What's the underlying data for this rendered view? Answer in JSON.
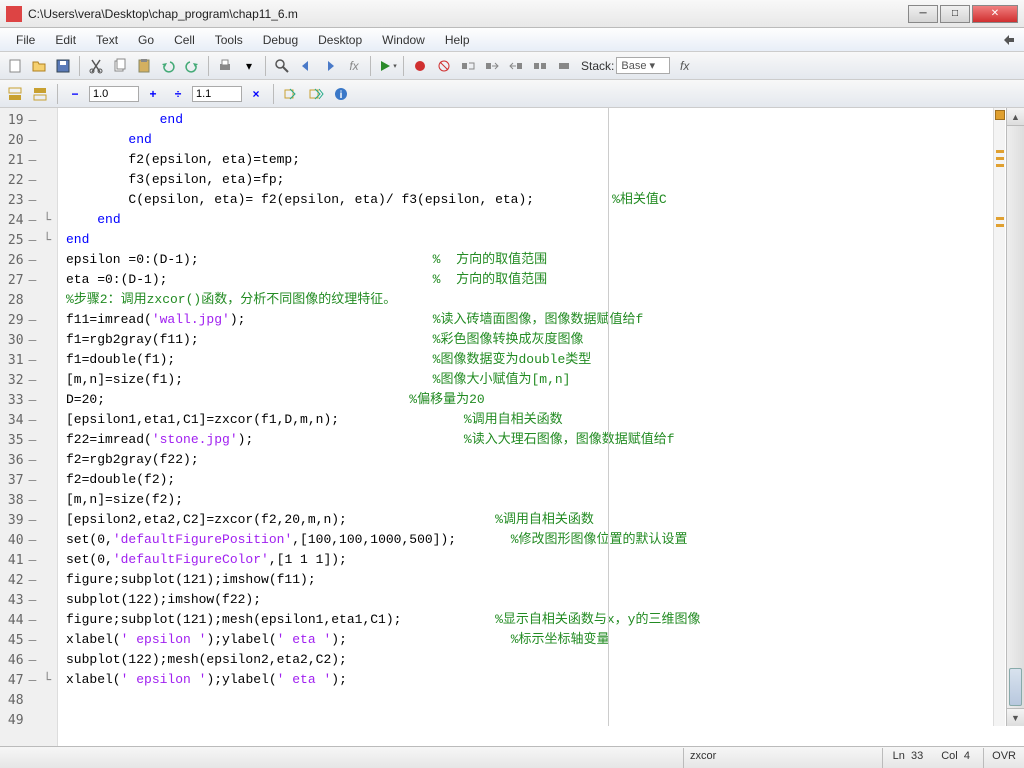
{
  "title": "C:\\Users\\vera\\Desktop\\chap_program\\chap11_6.m",
  "menu": [
    "File",
    "Edit",
    "Text",
    "Go",
    "Cell",
    "Tools",
    "Debug",
    "Desktop",
    "Window",
    "Help"
  ],
  "toolbar2": {
    "field1": "1.0",
    "field2": "1.1"
  },
  "stack": {
    "label": "Stack:",
    "value": "Base"
  },
  "gutter": [
    {
      "n": "19",
      "d": "—",
      "f": ""
    },
    {
      "n": "20",
      "d": "—",
      "f": ""
    },
    {
      "n": "21",
      "d": "—",
      "f": ""
    },
    {
      "n": "22",
      "d": "—",
      "f": ""
    },
    {
      "n": "23",
      "d": "—",
      "f": ""
    },
    {
      "n": "24",
      "d": "—",
      "f": "└"
    },
    {
      "n": "25",
      "d": "—",
      "f": "└"
    },
    {
      "n": "26",
      "d": "—",
      "f": ""
    },
    {
      "n": "27",
      "d": "—",
      "f": ""
    },
    {
      "n": "28",
      "d": "",
      "f": ""
    },
    {
      "n": "29",
      "d": "—",
      "f": ""
    },
    {
      "n": "30",
      "d": "—",
      "f": ""
    },
    {
      "n": "31",
      "d": "—",
      "f": ""
    },
    {
      "n": "32",
      "d": "—",
      "f": ""
    },
    {
      "n": "33",
      "d": "—",
      "f": ""
    },
    {
      "n": "34",
      "d": "—",
      "f": ""
    },
    {
      "n": "35",
      "d": "—",
      "f": ""
    },
    {
      "n": "36",
      "d": "—",
      "f": ""
    },
    {
      "n": "37",
      "d": "—",
      "f": ""
    },
    {
      "n": "38",
      "d": "—",
      "f": ""
    },
    {
      "n": "39",
      "d": "—",
      "f": ""
    },
    {
      "n": "40",
      "d": "—",
      "f": ""
    },
    {
      "n": "41",
      "d": "—",
      "f": ""
    },
    {
      "n": "42",
      "d": "—",
      "f": ""
    },
    {
      "n": "43",
      "d": "—",
      "f": ""
    },
    {
      "n": "44",
      "d": "—",
      "f": ""
    },
    {
      "n": "45",
      "d": "—",
      "f": ""
    },
    {
      "n": "46",
      "d": "—",
      "f": ""
    },
    {
      "n": "47",
      "d": "—",
      "f": "└"
    },
    {
      "n": "48",
      "d": "",
      "f": ""
    },
    {
      "n": "49",
      "d": "",
      "f": ""
    }
  ],
  "code": [
    {
      "seg": [
        {
          "t": "            ",
          "c": ""
        },
        {
          "t": "end",
          "c": "kw"
        }
      ]
    },
    {
      "seg": [
        {
          "t": "        ",
          "c": ""
        },
        {
          "t": "end",
          "c": "kw"
        }
      ]
    },
    {
      "seg": [
        {
          "t": "        f2(epsilon, eta)=temp;",
          "c": ""
        }
      ]
    },
    {
      "seg": [
        {
          "t": "        f3(epsilon, eta)=fp;",
          "c": ""
        }
      ]
    },
    {
      "seg": [
        {
          "t": "        C(epsilon, eta)= f2(epsilon, eta)/ f3(epsilon, eta);          ",
          "c": ""
        },
        {
          "t": "%相关值C",
          "c": "cmt"
        }
      ]
    },
    {
      "seg": [
        {
          "t": "    ",
          "c": ""
        },
        {
          "t": "end",
          "c": "kw"
        }
      ]
    },
    {
      "seg": [
        {
          "t": "end",
          "c": "kw"
        }
      ]
    },
    {
      "seg": [
        {
          "t": "epsilon =0:(D-1);                              ",
          "c": ""
        },
        {
          "t": "%  方向的取值范围",
          "c": "cmt"
        }
      ]
    },
    {
      "seg": [
        {
          "t": "eta =0:(D-1);                                  ",
          "c": ""
        },
        {
          "t": "%  方向的取值范围",
          "c": "cmt"
        }
      ]
    },
    {
      "seg": [
        {
          "t": "%步骤2：调用zxcor()函数，分析不同图像的纹理特征。",
          "c": "cmt"
        }
      ]
    },
    {
      "seg": [
        {
          "t": "f11=imread(",
          "c": ""
        },
        {
          "t": "'wall.jpg'",
          "c": "str"
        },
        {
          "t": ");                        ",
          "c": ""
        },
        {
          "t": "%读入砖墙面图像，图像数据赋值给f",
          "c": "cmt"
        }
      ]
    },
    {
      "seg": [
        {
          "t": "f1=rgb2gray(f11);                              ",
          "c": ""
        },
        {
          "t": "%彩色图像转换成灰度图像",
          "c": "cmt"
        }
      ]
    },
    {
      "seg": [
        {
          "t": "f1=double(f1);                                 ",
          "c": ""
        },
        {
          "t": "%图像数据变为double类型",
          "c": "cmt"
        }
      ]
    },
    {
      "seg": [
        {
          "t": "[m,n]=size(f1);                                ",
          "c": ""
        },
        {
          "t": "%图像大小赋值为[m,n]",
          "c": "cmt"
        }
      ]
    },
    {
      "seg": [
        {
          "t": "D=20;                                       ",
          "c": ""
        },
        {
          "t": "%偏移量为20",
          "c": "cmt"
        }
      ]
    },
    {
      "seg": [
        {
          "t": "[epsilon1,eta1,C1]=zxcor(f1,D,m,n);                ",
          "c": ""
        },
        {
          "t": "%调用自相关函数",
          "c": "cmt"
        }
      ]
    },
    {
      "seg": [
        {
          "t": "f22=imread(",
          "c": ""
        },
        {
          "t": "'stone.jpg'",
          "c": "str"
        },
        {
          "t": ");                           ",
          "c": ""
        },
        {
          "t": "%读入大理石图像，图像数据赋值给f",
          "c": "cmt"
        }
      ]
    },
    {
      "seg": [
        {
          "t": "f2=rgb2gray(f22);",
          "c": ""
        }
      ]
    },
    {
      "seg": [
        {
          "t": "f2=double(f2);",
          "c": ""
        }
      ]
    },
    {
      "seg": [
        {
          "t": "[m,n]=size(f2);",
          "c": ""
        }
      ]
    },
    {
      "seg": [
        {
          "t": "[epsilon2,eta2,C2]=zxcor(f2,20,m,n);                   ",
          "c": ""
        },
        {
          "t": "%调用自相关函数",
          "c": "cmt"
        }
      ]
    },
    {
      "seg": [
        {
          "t": "set(0,",
          "c": ""
        },
        {
          "t": "'defaultFigurePosition'",
          "c": "str"
        },
        {
          "t": ",[100,100,1000,500]);       ",
          "c": ""
        },
        {
          "t": "%修改图形图像位置的默认设置",
          "c": "cmt"
        }
      ]
    },
    {
      "seg": [
        {
          "t": "set(0,",
          "c": ""
        },
        {
          "t": "'defaultFigureColor'",
          "c": "str"
        },
        {
          "t": ",[1 1 1]);",
          "c": ""
        }
      ]
    },
    {
      "seg": [
        {
          "t": "figure;subplot(121);imshow(f11);",
          "c": ""
        }
      ]
    },
    {
      "seg": [
        {
          "t": "subplot(122);imshow(f22);",
          "c": ""
        }
      ]
    },
    {
      "seg": [
        {
          "t": "figure;subplot(121);mesh(epsilon1,eta1,C1);            ",
          "c": ""
        },
        {
          "t": "%显示自相关函数与x，y的三维图像",
          "c": "cmt"
        }
      ]
    },
    {
      "seg": [
        {
          "t": "xlabel(",
          "c": ""
        },
        {
          "t": "' epsilon '",
          "c": "str"
        },
        {
          "t": ");ylabel(",
          "c": ""
        },
        {
          "t": "' eta '",
          "c": "str"
        },
        {
          "t": ");                     ",
          "c": ""
        },
        {
          "t": "%标示坐标轴变量",
          "c": "cmt"
        }
      ]
    },
    {
      "seg": [
        {
          "t": "subplot(122);mesh(epsilon2,eta2,C2);",
          "c": ""
        }
      ]
    },
    {
      "seg": [
        {
          "t": "xlabel(",
          "c": ""
        },
        {
          "t": "' epsilon '",
          "c": "str"
        },
        {
          "t": ");ylabel(",
          "c": ""
        },
        {
          "t": "' eta '",
          "c": "str"
        },
        {
          "t": ");",
          "c": ""
        }
      ]
    },
    {
      "seg": [
        {
          "t": "",
          "c": ""
        }
      ]
    },
    {
      "seg": [
        {
          "t": "",
          "c": ""
        }
      ]
    }
  ],
  "status": {
    "func": "zxcor",
    "ln_label": "Ln",
    "ln": "33",
    "col_label": "Col",
    "col": "4",
    "ovr": "OVR"
  }
}
